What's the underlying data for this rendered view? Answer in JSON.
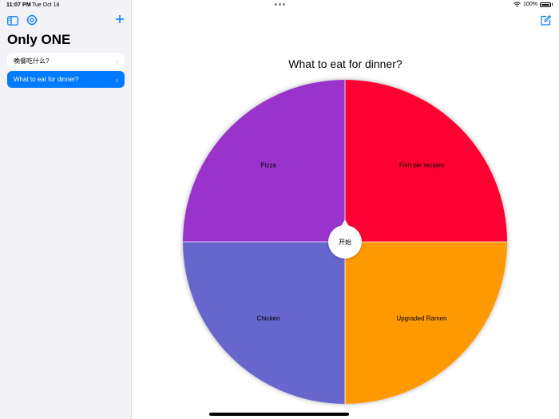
{
  "status": {
    "time": "11:07 PM",
    "date": "Tue Oct 18",
    "battery": "100%"
  },
  "sidebar": {
    "title": "Only ONE",
    "items": [
      {
        "label": "晚餐吃什么?",
        "selected": false
      },
      {
        "label": "What to eat for dinner?",
        "selected": true
      }
    ]
  },
  "main": {
    "title": "What to eat for dinner?",
    "start_label": "开始",
    "segments": [
      {
        "label": "Fish pie recipes",
        "color": "#ff0033"
      },
      {
        "label": "Upgraded Ramen",
        "color": "#ff9900"
      },
      {
        "label": "Chicken",
        "color": "#6666cc"
      },
      {
        "label": "Pizza",
        "color": "#9933cc"
      }
    ]
  },
  "icons": {
    "sidebar_toggle": "sidebar-toggle-icon",
    "settings": "settings-icon",
    "add": "plus-icon",
    "compose": "compose-icon",
    "wifi": "wifi-icon",
    "battery": "battery-icon",
    "chevron": "chevron-right-icon"
  }
}
